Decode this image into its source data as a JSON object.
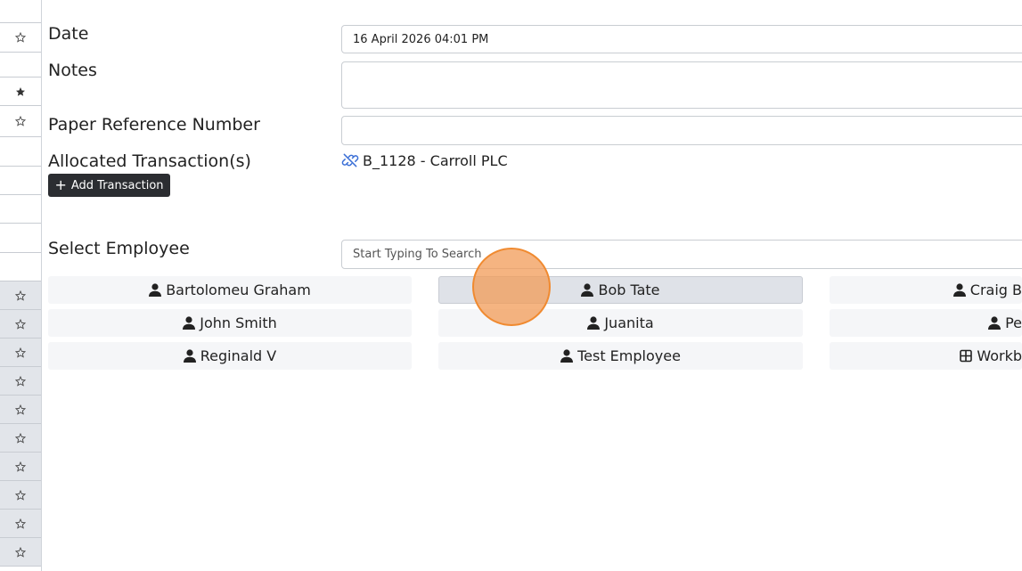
{
  "form": {
    "date_label": "Date",
    "date_value": "16 April 2026 04:01 PM",
    "notes_label": "Notes",
    "notes_value": "",
    "paper_ref_label": "Paper Reference Number",
    "paper_ref_value": "",
    "allocated_label": "Allocated Transaction(s)",
    "allocated_transaction": "B_1128 - Carroll PLC",
    "add_transaction_label": "Add Transaction",
    "select_employee_label": "Select Employee",
    "search_placeholder": "Start Typing To Search"
  },
  "employees": {
    "col1": [
      "Bartolomeu Graham",
      "John Smith",
      "Reginald V"
    ],
    "col2": [
      "Bob Tate",
      "Juanita",
      "Test Employee"
    ],
    "col3": [
      "Craig B",
      "Pe",
      "Workb"
    ],
    "selected": "Bob Tate"
  },
  "colors": {
    "accent_dark": "#2b2d31",
    "link_icon": "#3b6fd6",
    "cursor": "#f08a30"
  }
}
